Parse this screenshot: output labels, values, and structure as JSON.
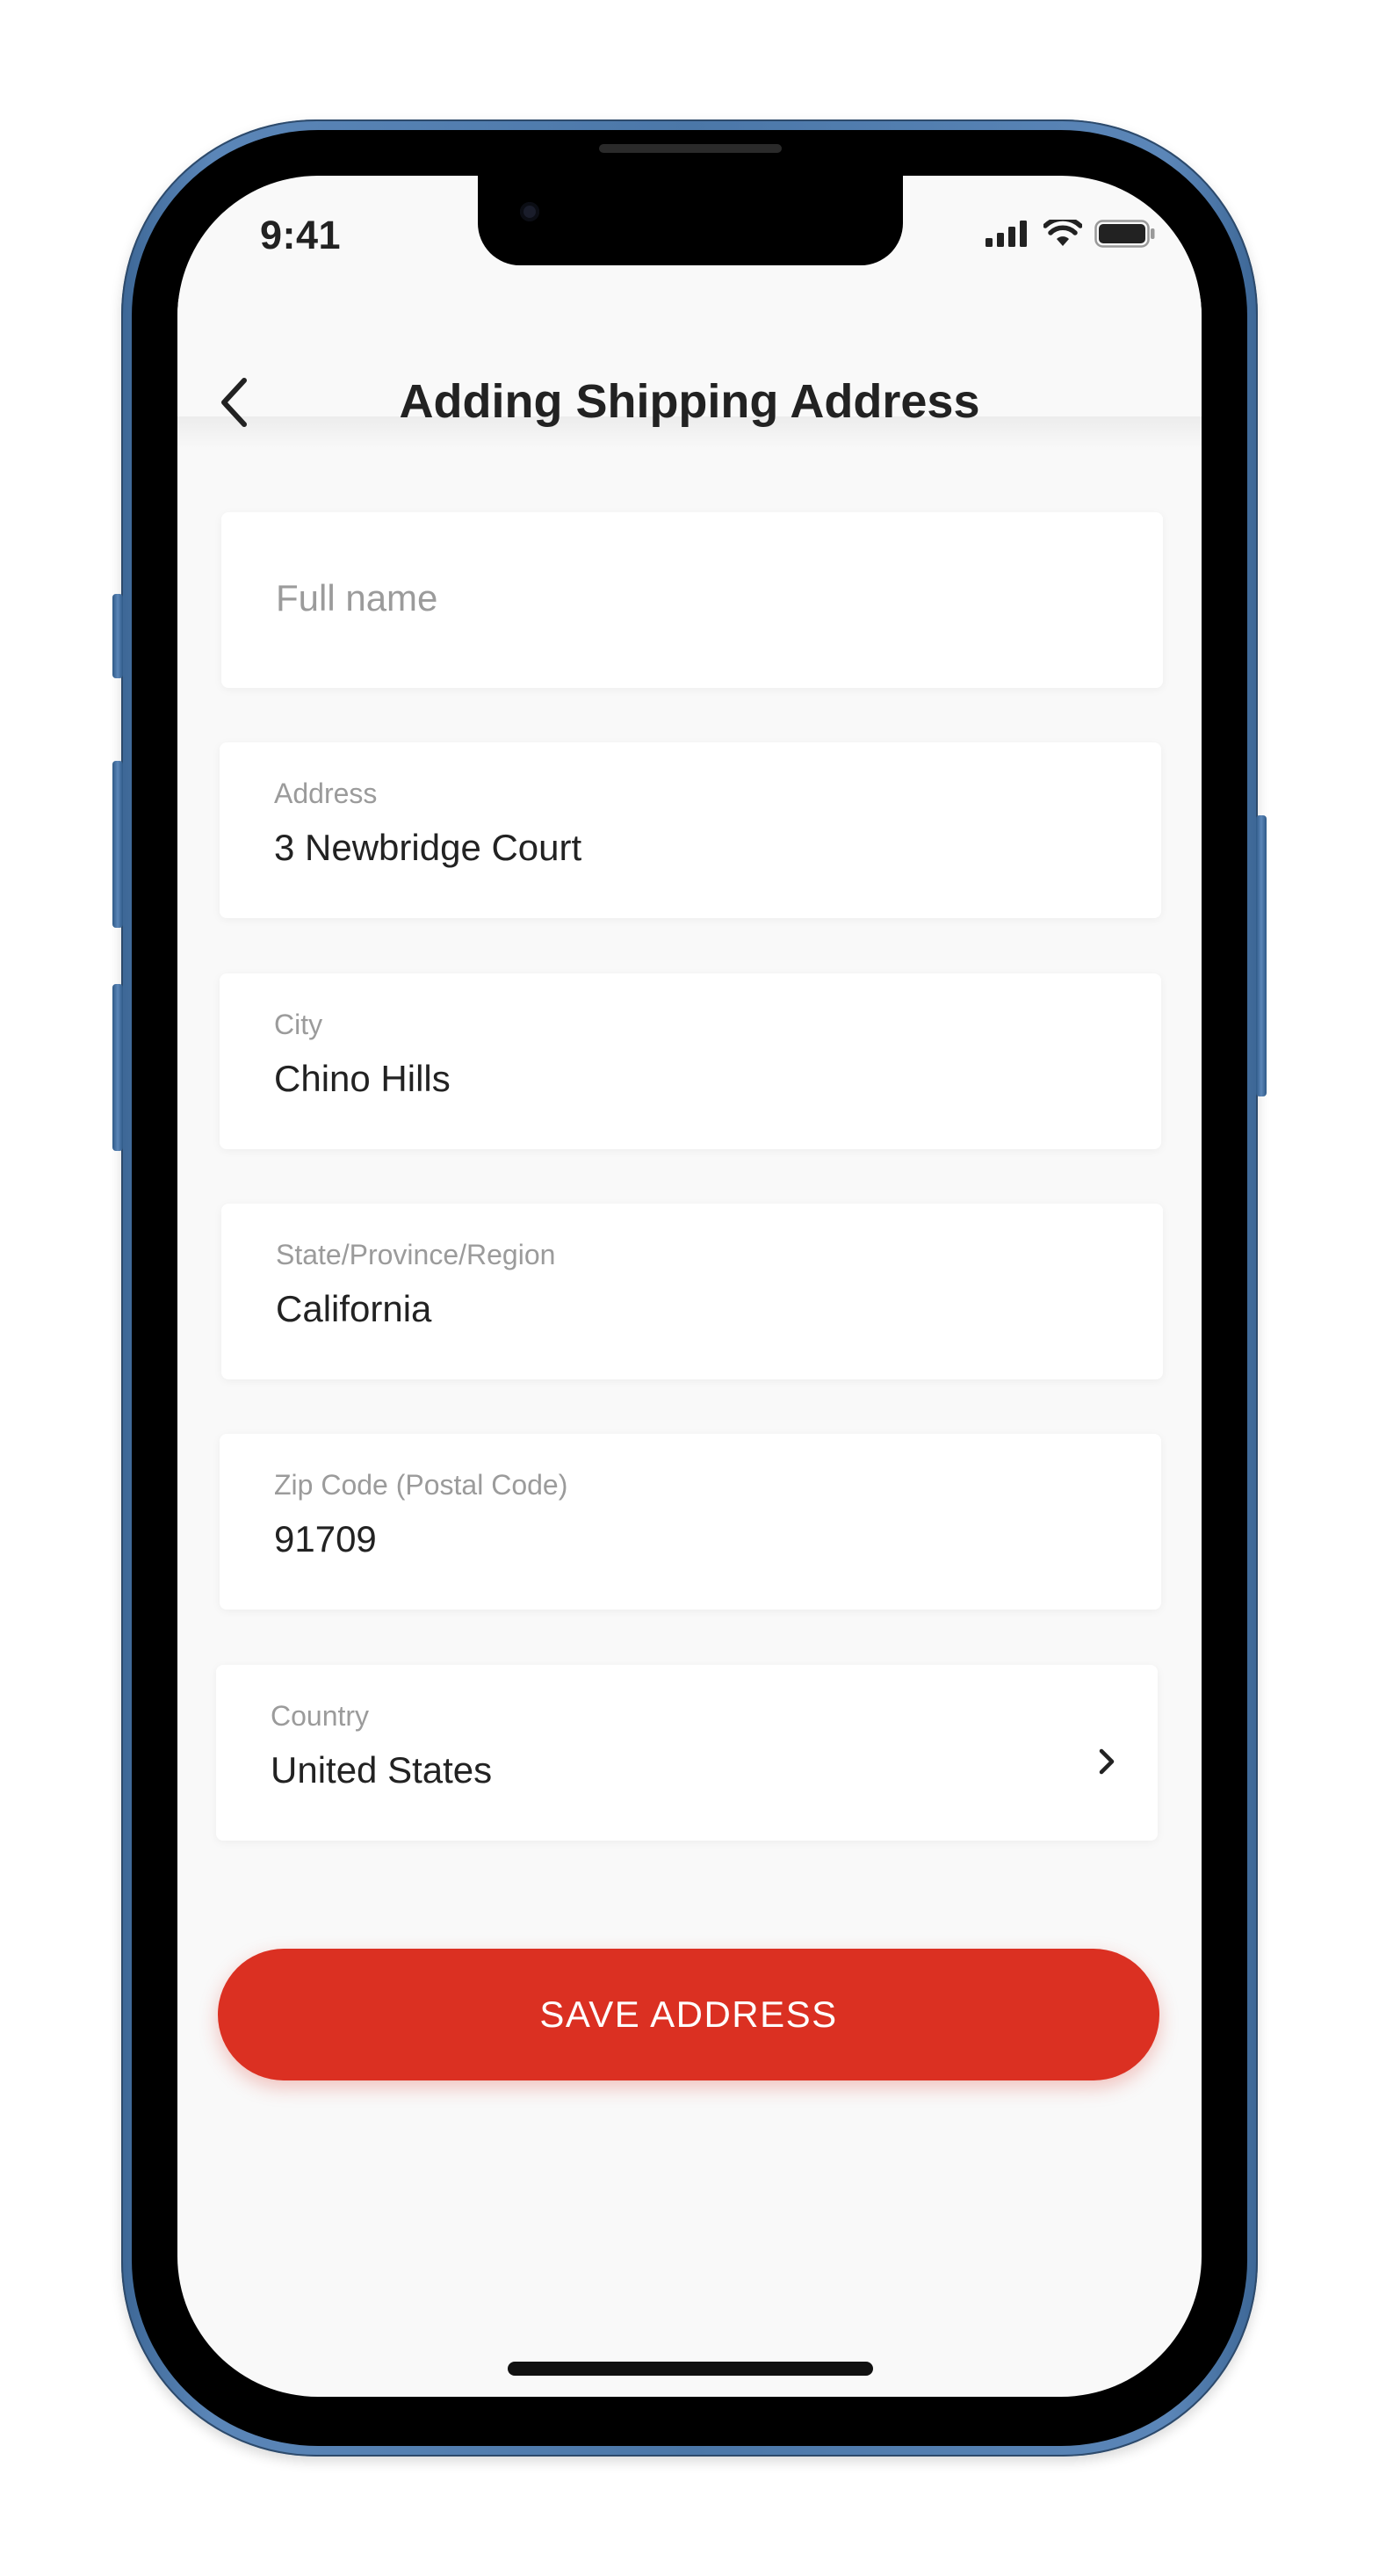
{
  "status_bar": {
    "time": "9:41",
    "signal_icon": "cellular-signal-icon",
    "wifi_icon": "wifi-icon",
    "battery_icon": "battery-icon"
  },
  "header": {
    "back_icon": "chevron-left-icon",
    "title": "Adding Shipping Address"
  },
  "form": {
    "full_name": {
      "placeholder": "Full name",
      "value": ""
    },
    "address": {
      "label": "Address",
      "value": "3 Newbridge Court"
    },
    "city": {
      "label": "City",
      "value": "Chino Hills"
    },
    "state": {
      "label": "State/Province/Region",
      "value": "California"
    },
    "zip": {
      "label": "Zip Code (Postal Code)",
      "value": "91709"
    },
    "country": {
      "label": "Country",
      "value": "United States",
      "chevron_icon": "chevron-right-icon"
    }
  },
  "actions": {
    "save_label": "SAVE ADDRESS"
  },
  "colors": {
    "accent": "#db3022",
    "background": "#f9f9f9",
    "card": "#ffffff",
    "text_primary": "#222222",
    "text_secondary": "#9b9b9b",
    "phone_frame": "#4b77a8"
  }
}
